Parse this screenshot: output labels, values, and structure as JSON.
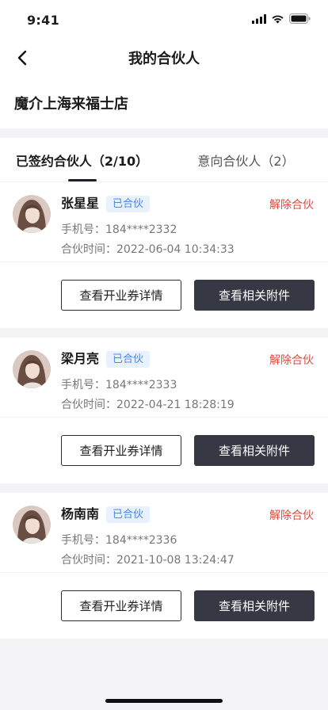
{
  "status_bar": {
    "time": "9:41"
  },
  "header": {
    "title": "我的合伙人",
    "back_icon": "chevron-left-icon"
  },
  "store": {
    "name": "魔介上海来福士店"
  },
  "tabs": [
    {
      "label": "已签约合伙人（2/10）",
      "active": true
    },
    {
      "label": "意向合伙人（2）",
      "active": false
    }
  ],
  "partners": [
    {
      "name": "张星星",
      "badge": "已合伙",
      "terminate_label": "解除合伙",
      "phone_line": "手机号：184****2332",
      "time_line": "合伙时间：2022-06-04 10:34:33",
      "btn_coupon": "查看开业券详情",
      "btn_attach": "查看相关附件"
    },
    {
      "name": "梁月亮",
      "badge": "已合伙",
      "terminate_label": "解除合伙",
      "phone_line": "手机号：184****2333",
      "time_line": "合伙时间：2022-04-21 18:28:19",
      "btn_coupon": "查看开业券详情",
      "btn_attach": "查看相关附件"
    },
    {
      "name": "杨南南",
      "badge": "已合伙",
      "terminate_label": "解除合伙",
      "phone_line": "手机号：184****2336",
      "time_line": "合伙时间：2021-10-08 13:24:47",
      "btn_coupon": "查看开业券详情",
      "btn_attach": "查看相关附件"
    }
  ],
  "colors": {
    "badge_bg": "#e8f1fd",
    "badge_text": "#4a86e8",
    "terminate": "#e0483c",
    "dark_button": "#363844"
  }
}
